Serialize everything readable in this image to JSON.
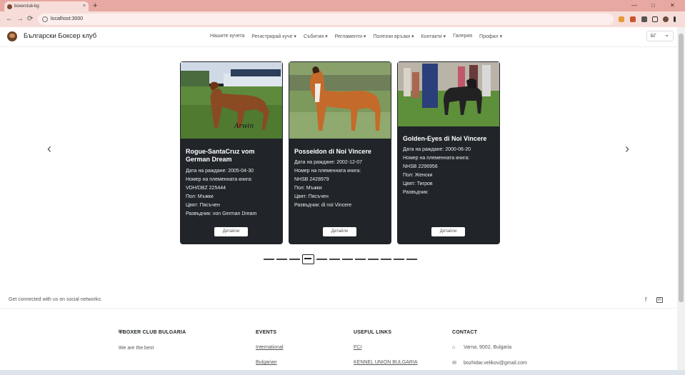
{
  "browser": {
    "tab_title": "boxerclub-bg",
    "tab_close": "×",
    "new_tab": "+",
    "minimize": "—",
    "maximize": "□",
    "close": "✕",
    "back": "←",
    "forward": "→",
    "reload": "⟳",
    "url": "localhost:3000"
  },
  "navbar": {
    "brand": "Български Боксер клуб",
    "menu": [
      "Нашите кучета",
      "Регистрирай куче ▾",
      "Събития ▾",
      "Регламенти ▾",
      "Полезни връзки ▾",
      "Контакти ▾",
      "Галерия",
      "Профил ▾"
    ],
    "language": "БГ"
  },
  "carousel": {
    "prev": "‹",
    "next": "›",
    "cards": [
      {
        "name": "Rogue-SantaCruz vom German Dream",
        "lines": [
          "Дата на раждане: 2005-04-30",
          "Номер на племенната книга:",
          "VDH/DBZ 225444",
          "Пол: Мъжки",
          "Цвят: Пясъчен",
          "Развъдчик: von German Dream"
        ],
        "photo_caption": "Arwin",
        "button": "Детайли"
      },
      {
        "name": "Posseidon di Noi Vincere",
        "lines": [
          "Дата на раждане: 2002-12-07",
          "Номер на племенната книга:",
          "NHSB 2428979",
          "Пол: Мъжки",
          "Цвят: Пясъчен",
          "Развъдчик: di noi Vincere"
        ],
        "photo_caption": "",
        "button": "Детайли"
      },
      {
        "name": "Golden-Eyes di Noi Vincere",
        "lines": [
          "Дата на раждане: 2000-06-20",
          "Номер на племенната книга:",
          "NHSB 2296956",
          "Пол: Женски",
          "Цвят: Тигров",
          "Развъдчик:"
        ],
        "photo_caption": "",
        "button": "Детайли"
      }
    ],
    "indicator_count": 12,
    "active_index": 3
  },
  "footer": {
    "social_text": "Get connected with us on social networks:",
    "social_icons": [
      "f",
      "in"
    ],
    "brand_heading": "BOXER CLUB BULGARIA",
    "brand_text": "We are the best",
    "events_heading": "EVENTS",
    "events": [
      "International",
      "Bulgarian"
    ],
    "links_heading": "USEFUL LINKS",
    "links": [
      "FCI",
      "KENNEL UNION BULGARIA"
    ],
    "contact_heading": "CONTACT",
    "address": "Varna, 9002, Bulgaria",
    "email": "bozhidar.velikov@gmail.com"
  }
}
